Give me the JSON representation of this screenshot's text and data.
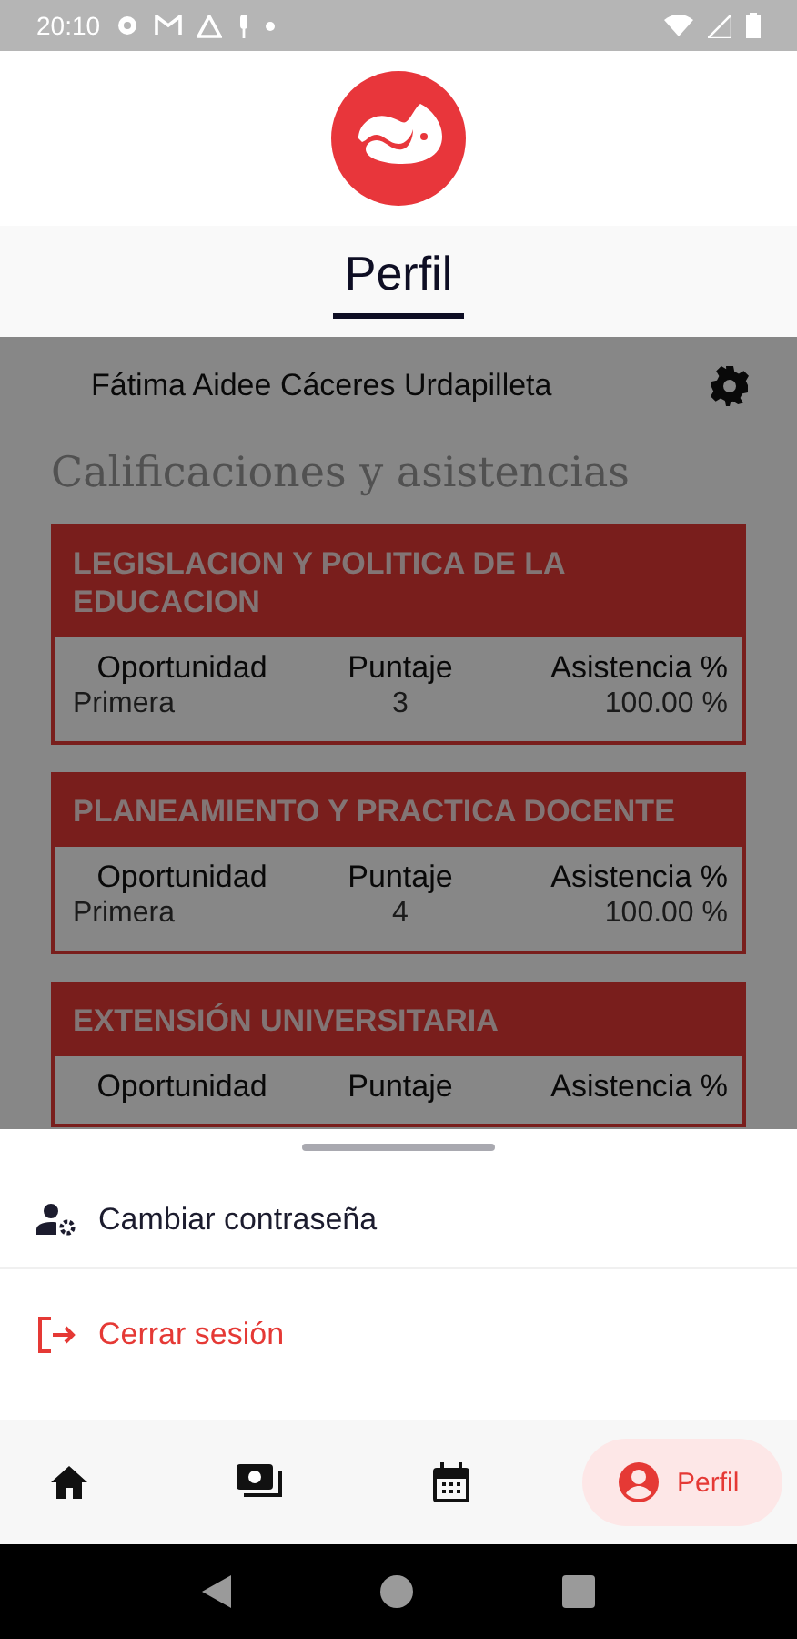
{
  "status_bar": {
    "time": "20:10"
  },
  "tabs": [
    {
      "label": "Perfil",
      "selected": true
    }
  ],
  "profile": {
    "name": "Fátima Aidee Cáceres Urdapilleta"
  },
  "section_title": "Calificaciones y asistencias",
  "courses": [
    {
      "name": "LEGISLACION Y POLITICA DE LA EDUCACION",
      "columns": [
        "Oportunidad",
        "Puntaje",
        "Asistencia %"
      ],
      "rows": [
        {
          "opportunity": "Primera",
          "score": "3",
          "attendance": "100.00 %"
        }
      ]
    },
    {
      "name": "PLANEAMIENTO Y PRACTICA DOCENTE",
      "columns": [
        "Oportunidad",
        "Puntaje",
        "Asistencia %"
      ],
      "rows": [
        {
          "opportunity": "Primera",
          "score": "4",
          "attendance": "100.00 %"
        }
      ]
    },
    {
      "name": "EXTENSIÓN UNIVERSITARIA",
      "columns": [
        "Oportunidad",
        "Puntaje",
        "Asistencia %"
      ]
    }
  ],
  "sheet": {
    "items": [
      {
        "label": "Cambiar contraseña",
        "kind": "password"
      },
      {
        "label": "Cerrar sesión",
        "kind": "logout"
      }
    ]
  },
  "nav": {
    "items": [
      {
        "kind": "home",
        "selected": false
      },
      {
        "kind": "payments",
        "selected": false
      },
      {
        "kind": "calendar",
        "selected": false
      },
      {
        "kind": "profile",
        "label": "Perfil",
        "selected": true
      }
    ]
  }
}
